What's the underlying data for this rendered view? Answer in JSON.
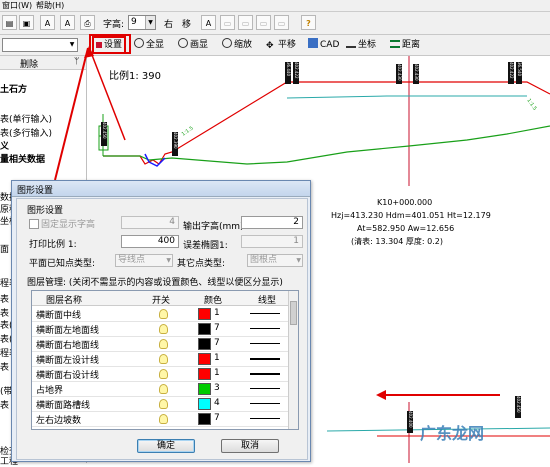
{
  "menubar": {
    "items": [
      "窗口(W)",
      "帮助(H)"
    ]
  },
  "toolbar": {
    "zigao_label": "字高:",
    "zigao_value": "9",
    "right_label": "右",
    "move_label": "移"
  },
  "toolbar2": {
    "items": [
      "设置",
      "全显",
      "画显",
      "缩放",
      "平移",
      "CAD",
      "坐标",
      "距离"
    ]
  },
  "left_panel": {
    "delete_label": "删除",
    "pin_label": "ᛘ",
    "lines": [
      "土石方",
      "表(单行输入)",
      "表(多行输入)",
      "义",
      "量相关数据",
      "",
      "",
      "数据",
      "原程数",
      "坐标数",
      "",
      "面",
      "",
      "",
      "程表",
      "表",
      "表",
      "表(断",
      "表(高",
      "程表",
      "表",
      "",
      "(带断",
      "表",
      "",
      "",
      "检查",
      "工程"
    ]
  },
  "canvas": {
    "scale_label": "比例1: 390",
    "station": "K10+000.000",
    "line1": "Hzj=413.230  Hdm=401.051  Ht=12.179",
    "line2": "At=582.950   Aw=12.656",
    "line3": "(清表: 13.304  厚度: 0.2)",
    "slope_left": "1:1.5",
    "slope_right": "1:1.5",
    "tags": [
      "36.440",
      "402.422",
      "402.430",
      "402.430",
      "402.422",
      "36.540",
      "402.450",
      "402.390",
      "402.400",
      "402.450"
    ]
  },
  "dialog": {
    "title": "图形设置",
    "group_label": "图形设置",
    "fixed_height_label": "固定显示字高",
    "fixed_height_value": "4",
    "output_height_label": "输出字高(mm)",
    "output_height_value": "2",
    "print_scale_label": "打印比例  1:",
    "print_scale_value": "400",
    "ellipse_label": "误差椭圆1:",
    "ellipse_value": "1",
    "known_point_label": "平面已知点类型:",
    "known_point_value": "导线点",
    "other_point_label": "其它点类型:",
    "other_point_value": "图根点",
    "layer_mgmt_label": "图层管理: (关闭不需显示的内容或设置颜色、线型以便区分显示)",
    "columns": [
      "图层名称",
      "开关",
      "颜色",
      "线型"
    ],
    "rows": [
      {
        "name": "横断面中线",
        "color": "#ff0000",
        "color_num": "1",
        "line": "thin"
      },
      {
        "name": "横断面左地面线",
        "color": "#000000",
        "color_num": "7",
        "line": "thin"
      },
      {
        "name": "横断面右地面线",
        "color": "#000000",
        "color_num": "7",
        "line": "thin"
      },
      {
        "name": "横断面左设计线",
        "color": "#ff0000",
        "color_num": "1",
        "line": "thick"
      },
      {
        "name": "横断面右设计线",
        "color": "#ff0000",
        "color_num": "1",
        "line": "thick"
      },
      {
        "name": "占地界",
        "color": "#00cc00",
        "color_num": "3",
        "line": "thin"
      },
      {
        "name": "横断面路槽线",
        "color": "#00ffff",
        "color_num": "4",
        "line": "thin"
      },
      {
        "name": "左右边坡数",
        "color": "#000000",
        "color_num": "7",
        "line": "thin"
      }
    ],
    "ok_label": "确定",
    "cancel_label": "取消"
  },
  "watermark": "广东龙网"
}
